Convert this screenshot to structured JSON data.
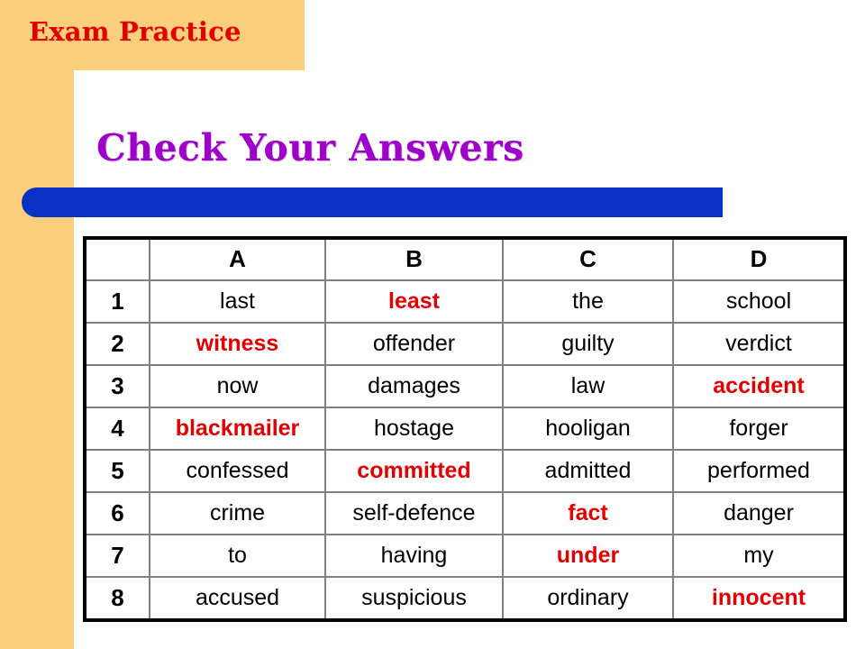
{
  "header": {
    "label": "Exam Practice"
  },
  "title": {
    "text": "Check Your Answers"
  },
  "colors": {
    "sidebar_yellow": "#FBCF7C",
    "header_red": "#E00000",
    "title_purple": "#9D00C8",
    "divider_blue": "#0A32C2",
    "correct_red": "#E00000",
    "text_black": "#000000",
    "grid_gray": "#808080",
    "border_black": "#000000",
    "panel_white": "#FFFFFF"
  },
  "table": {
    "corner_label": "",
    "columns": [
      "A",
      "B",
      "C",
      "D"
    ],
    "rows": [
      {
        "number": "1",
        "cells": [
          "last",
          "least",
          "the",
          "school"
        ],
        "correct": 1
      },
      {
        "number": "2",
        "cells": [
          "witness",
          "offender",
          "guilty",
          "verdict"
        ],
        "correct": 0
      },
      {
        "number": "3",
        "cells": [
          "now",
          "damages",
          "law",
          "accident"
        ],
        "correct": 3
      },
      {
        "number": "4",
        "cells": [
          "blackmailer",
          "hostage",
          "hooligan",
          "forger"
        ],
        "correct": 0
      },
      {
        "number": "5",
        "cells": [
          "confessed",
          "committed",
          "admitted",
          "performed"
        ],
        "correct": 1
      },
      {
        "number": "6",
        "cells": [
          "crime",
          "self-defence",
          "fact",
          "danger"
        ],
        "correct": 2
      },
      {
        "number": "7",
        "cells": [
          "to",
          "having",
          "under",
          "my"
        ],
        "correct": 2
      },
      {
        "number": "8",
        "cells": [
          "accused",
          "suspicious",
          "ordinary",
          "innocent"
        ],
        "correct": 3
      }
    ]
  }
}
